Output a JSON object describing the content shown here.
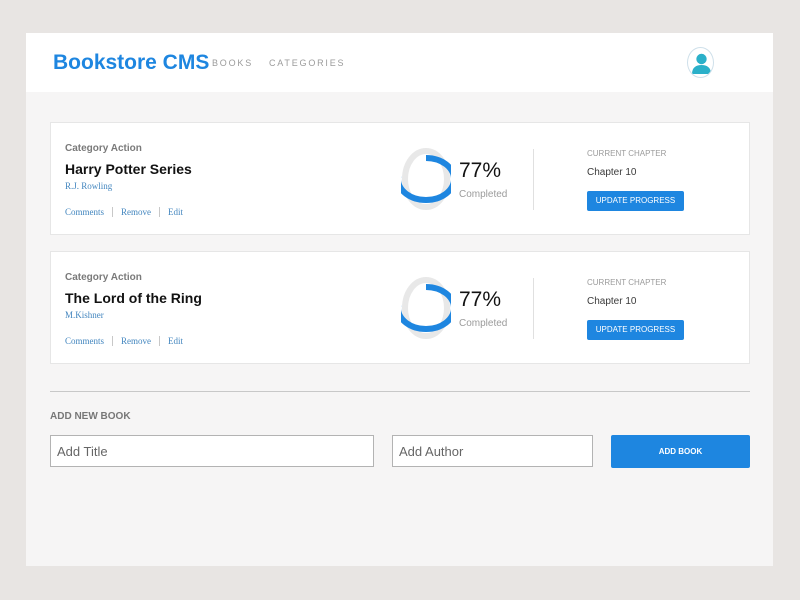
{
  "header": {
    "brand": "Bookstore CMS",
    "nav": [
      {
        "label": "BOOKS"
      },
      {
        "label": "CATEGORIES"
      }
    ],
    "avatar_icon": "user-icon"
  },
  "books": [
    {
      "category": "Category Action",
      "title": "Harry Potter Series",
      "author": "R.J. Rowling",
      "actions": [
        "Comments",
        "Remove",
        "Edit"
      ],
      "progress_percent": 77,
      "progress_label": "77%",
      "completed_label": "Completed",
      "current_chapter_label": "CURRENT CHAPTER",
      "chapter": "Chapter 10",
      "update_label": "UPDATE PROGRESS"
    },
    {
      "category": "Category Action",
      "title": "The Lord of the Ring",
      "author": "M.Kishner",
      "actions": [
        "Comments",
        "Remove",
        "Edit"
      ],
      "progress_percent": 77,
      "progress_label": "77%",
      "completed_label": "Completed",
      "current_chapter_label": "CURRENT CHAPTER",
      "chapter": "Chapter 10",
      "update_label": "UPDATE PROGRESS"
    }
  ],
  "add_form": {
    "heading": "ADD NEW BOOK",
    "title_placeholder": "Add Title",
    "author_placeholder": "Add Author",
    "button_label": "ADD BOOK"
  },
  "colors": {
    "accent": "#1e86e0",
    "background": "#f6f5f5",
    "ring_track": "#e8e8e8"
  }
}
